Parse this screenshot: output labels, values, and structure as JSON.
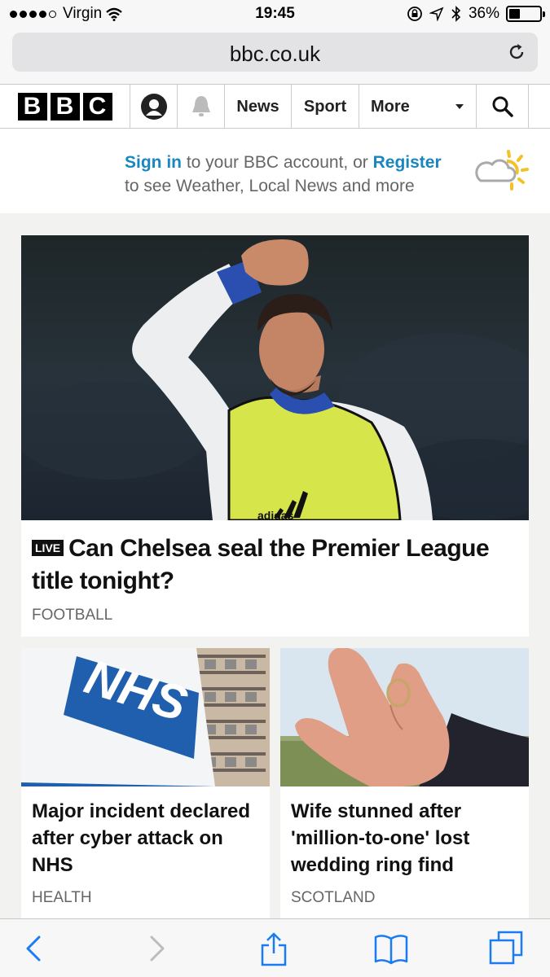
{
  "status_bar": {
    "carrier": "Virgin",
    "time": "19:45",
    "battery_percent": "36%",
    "battery_level": 0.36
  },
  "address_bar": {
    "url": "bbc.co.uk"
  },
  "bbc_nav": {
    "logo_letters": [
      "B",
      "B",
      "C"
    ],
    "items": [
      "News",
      "Sport",
      "More"
    ]
  },
  "signin_banner": {
    "sign_in_link": "Sign in",
    "text_1": " to your BBC account, or ",
    "register_link": "Register",
    "text_2": "to see Weather, Local News and more"
  },
  "main_story": {
    "live_label": "LIVE",
    "headline": "Can Chelsea seal the Premier League title tonight?",
    "tag": "FOOTBALL",
    "image_sign_text": "adidas"
  },
  "stories": [
    {
      "headline": "Major incident declared after cyber attack on NHS",
      "tag": "HEALTH",
      "image_sign_text": "NHS"
    },
    {
      "headline": "Wife stunned after 'million-to-one' lost wedding ring find",
      "tag": "SCOTLAND"
    }
  ],
  "colors": {
    "link_blue": "#1a86c0",
    "nhs_blue": "#1f5fae",
    "bib_yellow": "#d6e64a",
    "sun_yellow": "#f2c22a"
  },
  "icons": {
    "back": "chevron-left-icon",
    "forward": "chevron-right-icon",
    "share": "share-icon",
    "bookmarks": "book-icon",
    "tabs": "tabs-icon",
    "reload": "reload-icon",
    "search": "search-icon",
    "notifications": "bell-icon",
    "account": "account-icon",
    "weather": "cloud-sun-icon"
  }
}
